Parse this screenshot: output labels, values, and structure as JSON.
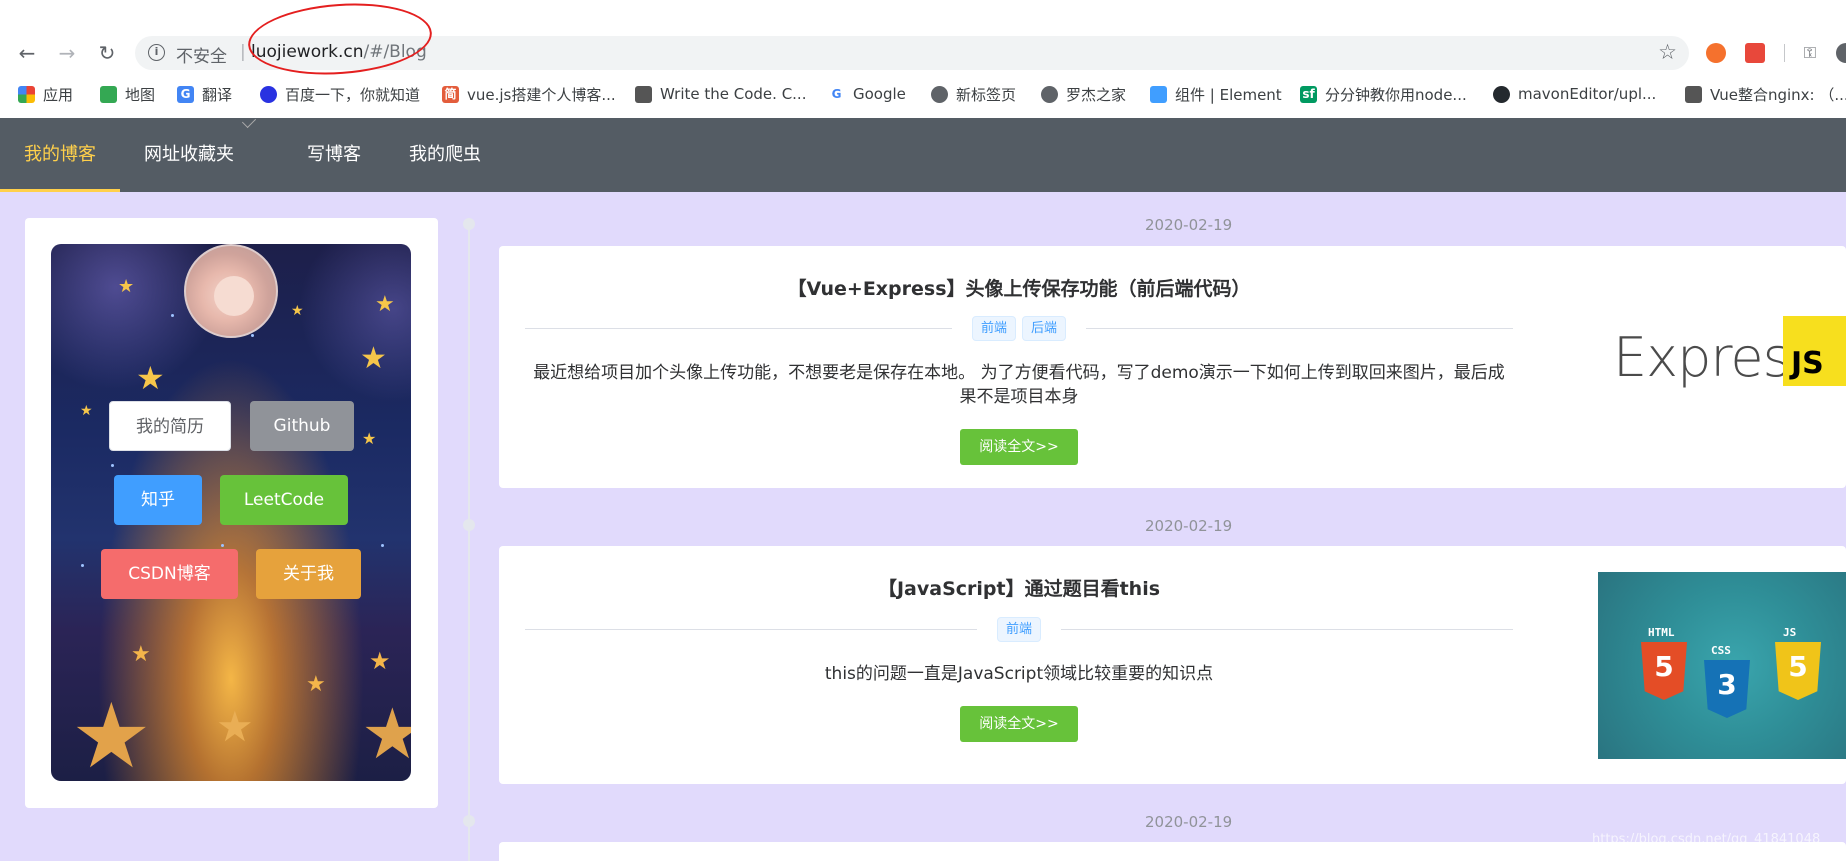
{
  "browser": {
    "url_security": "不安全",
    "url_host": "luojiework.cn",
    "url_path": "/#/Blog",
    "bookmarks": [
      {
        "label": "应用",
        "icon": "apps-grid-icon",
        "color": "#ea4335"
      },
      {
        "label": "地图",
        "icon": "maps-icon",
        "color": "#34a853"
      },
      {
        "label": "翻译",
        "icon": "translate-icon",
        "color": "#4285f4"
      },
      {
        "label": "百度一下，你就知道",
        "icon": "baidu-paw-icon",
        "color": "#2932e1"
      },
      {
        "label": "vue.js搭建个人博客...",
        "icon": "jian-icon",
        "color": "#e35d3c"
      },
      {
        "label": "Write the Code. C...",
        "icon": "avatar-icon",
        "color": "#555555"
      },
      {
        "label": "Google",
        "icon": "google-icon",
        "color": "#4285f4"
      },
      {
        "label": "新标签页",
        "icon": "globe-icon",
        "color": "#5f6368"
      },
      {
        "label": "罗杰之家",
        "icon": "globe-icon",
        "color": "#5f6368"
      },
      {
        "label": "组件 | Element",
        "icon": "element-icon",
        "color": "#409eff"
      },
      {
        "label": "分分钟教你用node...",
        "icon": "sf-icon",
        "color": "#009a61"
      },
      {
        "label": "mavonEditor/upl...",
        "icon": "github-icon",
        "color": "#24292e"
      },
      {
        "label": "Vue整合nginx: （...",
        "icon": "vue-icon",
        "color": "#555555"
      }
    ]
  },
  "site_nav": {
    "items": [
      {
        "label": "我的博客",
        "active": true
      },
      {
        "label": "网址收藏夹",
        "active": false
      },
      {
        "label": "写博客",
        "active": false
      },
      {
        "label": "我的爬虫",
        "active": false
      }
    ]
  },
  "profile": {
    "buttons": [
      {
        "label": "我的简历",
        "style": "white"
      },
      {
        "label": "Github",
        "style": "gray"
      },
      {
        "label": "知乎",
        "style": "blue"
      },
      {
        "label": "LeetCode",
        "style": "green"
      },
      {
        "label": "CSDN博客",
        "style": "red"
      },
      {
        "label": "关于我",
        "style": "orange"
      }
    ]
  },
  "posts": [
    {
      "date": "2020-02-19",
      "title": "【Vue+Express】头像上传保存功能（前后端代码）",
      "tags": [
        "前端",
        "后端"
      ],
      "summary": "最近想给项目加个头像上传功能，不想要老是保存在本地。 为了方便看代码，写了demo演示一下如何上传到取回来图片，最后成果不是项目本身",
      "read_more": "阅读全文>>",
      "thumb": {
        "word": "Express",
        "badge": "JS"
      }
    },
    {
      "date": "2020-02-19",
      "title": "【JavaScript】通过题目看this",
      "tags": [
        "前端"
      ],
      "summary": "this的问题一直是JavaScript领域比较重要的知识点",
      "read_more": "阅读全文>>",
      "thumb": {
        "labels": [
          "HTML",
          "CSS",
          "JS"
        ],
        "digits": [
          "5",
          "3",
          "5"
        ]
      }
    },
    {
      "date": "2020-02-19"
    }
  ],
  "watermark": "https://blog.csdn.net/qq_41841048",
  "colors": {
    "accent": "#ffd04b",
    "nav_bg": "#545c64",
    "page_bg": "#e1dafc",
    "tag_blue": "#409eff",
    "read_green": "#67c23a",
    "annotation_red": "#e41f1f"
  }
}
